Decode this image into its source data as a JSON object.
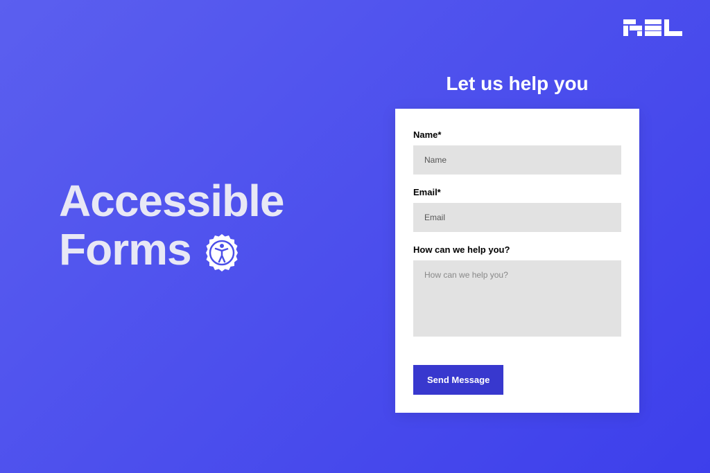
{
  "hero": {
    "title_line1": "Accessible",
    "title_line2": "Forms"
  },
  "form": {
    "heading": "Let us help you",
    "name": {
      "label": "Name*",
      "placeholder": "Name"
    },
    "email": {
      "label": "Email*",
      "placeholder": "Email"
    },
    "message": {
      "label": "How can we help you?",
      "placeholder": "How can we help you?"
    },
    "submit_label": "Send Message"
  }
}
